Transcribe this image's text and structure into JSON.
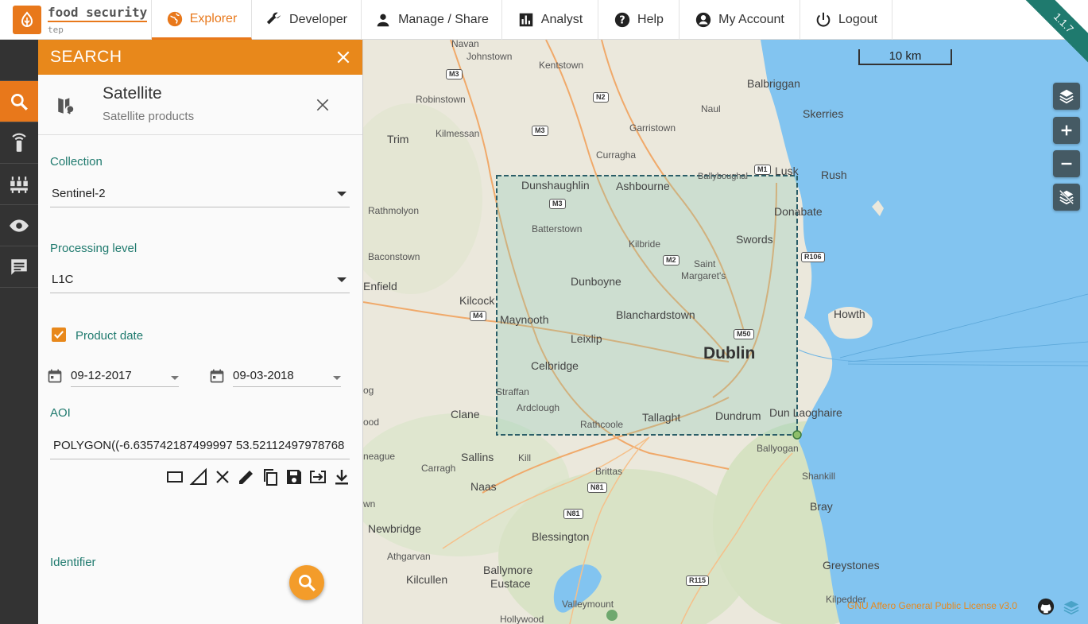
{
  "brand": {
    "name": "food security",
    "sub": "tep"
  },
  "nav": {
    "explorer": "Explorer",
    "developer": "Developer",
    "manage": "Manage / Share",
    "analyst": "Analyst",
    "help": "Help",
    "account": "My Account",
    "logout": "Logout"
  },
  "version": "1.1.7",
  "search_panel": {
    "title": "SEARCH",
    "source_title": "Satellite",
    "source_subtitle": "Satellite products",
    "collection_label": "Collection",
    "collection_value": "Sentinel-2",
    "processing_label": "Processing level",
    "processing_value": "L1C",
    "product_date_label": "Product date",
    "product_date_checked": true,
    "date_start": "09-12-2017",
    "date_end": "09-03-2018",
    "aoi_label": "AOI",
    "aoi_value": "POLYGON((-6.635742187499997 53.52112497978768",
    "identifier_label": "Identifier"
  },
  "map": {
    "scale": "10 km",
    "license": "GNU Affero General Public License v3.0",
    "places": {
      "navan": "Navan",
      "johnstown": "Johnstown",
      "kentstown": "Kentstown",
      "balbriggan": "Balbriggan",
      "robinstown": "Robinstown",
      "naul": "Naul",
      "skerries": "Skerries",
      "garristown": "Garristown",
      "kilmessan": "Kilmessan",
      "trim": "Trim",
      "curragha": "Curragha",
      "lusk": "Lusk",
      "rush": "Rush",
      "ballyboughal": "Ballyboughal",
      "dunshaughlin": "Dunshaughlin",
      "ashbourne": "Ashbourne",
      "rathmolyon": "Rathmolyon",
      "donabate": "Donabate",
      "batterstown": "Batterstown",
      "swords": "Swords",
      "kilbride": "Kilbride",
      "baconstown": "Baconstown",
      "saint": "Saint",
      "margarets": "Margaret's",
      "enfield": "Enfield",
      "dunboyne": "Dunboyne",
      "kilcock": "Kilcock",
      "howth": "Howth",
      "blanchardstown": "Blanchardstown",
      "maynooth": "Maynooth",
      "leixlip": "Leixlip",
      "dublin": "Dublin",
      "celbridge": "Celbridge",
      "straffan": "Straffan",
      "ardclough": "Ardclough",
      "tallaght": "Tallaght",
      "dundrum": "Dundrum",
      "dunlaoghaire": "Dun Laoghaire",
      "clane": "Clane",
      "rathcoole": "Rathcoole",
      "ballyogan": "Ballyogan",
      "sallins": "Sallins",
      "kill": "Kill",
      "carragh": "Carragh",
      "brittas": "Brittas",
      "shankill": "Shankill",
      "naas": "Naas",
      "bray": "Bray",
      "newbridge": "Newbridge",
      "blessington": "Blessington",
      "athgarvan": "Athgarvan",
      "greystones": "Greystones",
      "ballymore": "Ballymore",
      "eustace": "Eustace",
      "kilcullen": "Kilcullen",
      "valleymount": "Valleymount",
      "kilpedder": "Kilpedder",
      "hollywood": "Hollywood",
      "edge_og": "og",
      "edge_ood": "ood",
      "edge_neague": "neague",
      "edge_wn": "wn"
    },
    "roads": {
      "m3a": "M3",
      "m3b": "M3",
      "m3c": "M3",
      "n2": "N2",
      "m1": "M1",
      "m2": "M2",
      "r106": "R106",
      "m4": "M4",
      "m50": "M50",
      "n81a": "N81",
      "n81b": "N81",
      "r115": "R115"
    }
  },
  "colors": {
    "accent": "#e8881b",
    "teal": "#1f7a6e",
    "rail": "#333333",
    "water": "#82c4f0",
    "land": "#ebe8dc"
  },
  "icons": [
    "globe-icon",
    "wrench-icon",
    "person-icon",
    "bar-chart-icon",
    "help-icon",
    "account-icon",
    "power-icon",
    "search-icon",
    "tower-icon",
    "data-icon",
    "eye-icon",
    "comment-icon",
    "satellite-icon",
    "close-icon",
    "calendar-icon",
    "layers-icon",
    "zoom-in-icon",
    "zoom-out-icon",
    "layer-off-icon",
    "github-icon"
  ]
}
